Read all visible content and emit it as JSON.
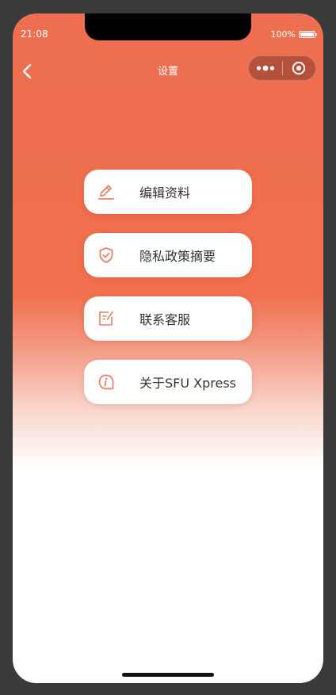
{
  "status_bar": {
    "time": "21:08",
    "battery": "100%"
  },
  "nav": {
    "title": "设置"
  },
  "menu": {
    "items": [
      {
        "label": "编辑资料",
        "icon": "edit-icon"
      },
      {
        "label": "隐私政策摘要",
        "icon": "shield-check-icon"
      },
      {
        "label": "联系客服",
        "icon": "note-edit-icon"
      },
      {
        "label": "关于SFU Xpress",
        "icon": "info-icon"
      }
    ]
  },
  "colors": {
    "header_gradient_top": "#ee6f50",
    "icon_accent": "#e8806a",
    "label_text": "#333333"
  }
}
